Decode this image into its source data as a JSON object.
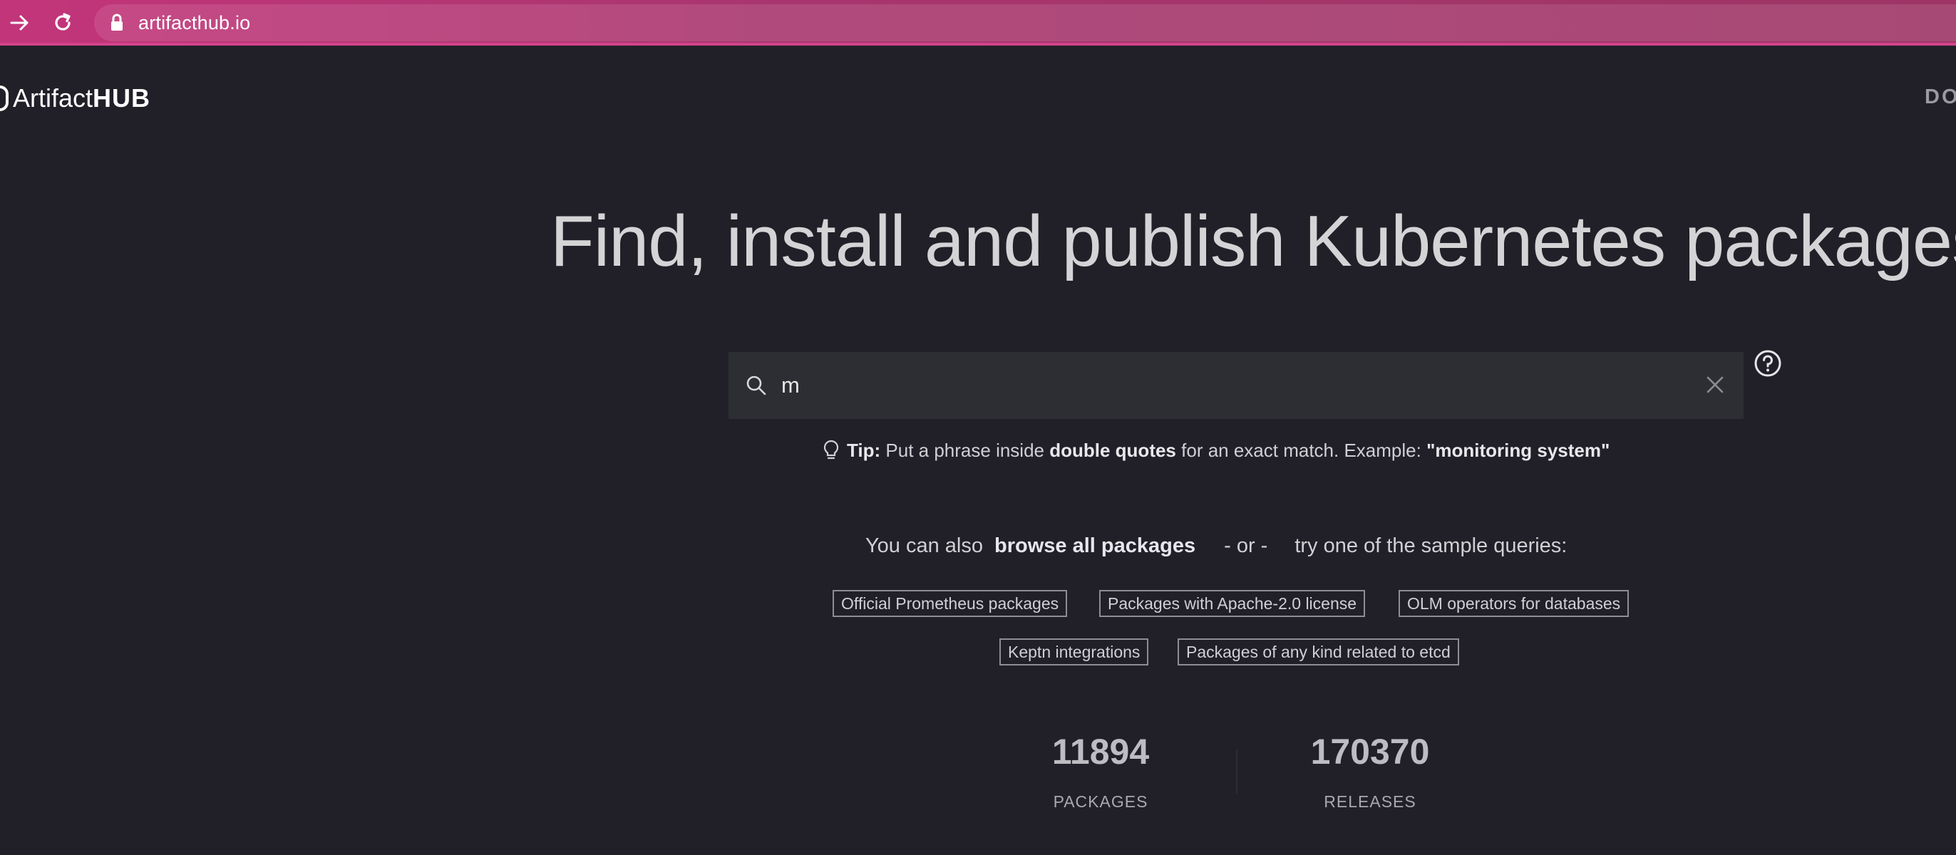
{
  "browser": {
    "url": "artifacthub.io"
  },
  "header": {
    "logo_prefix": "Artifact",
    "logo_strong": "HUB",
    "nav_link": "DO"
  },
  "hero": {
    "title": "Find, install and publish Kubernetes packages"
  },
  "search": {
    "value": "m"
  },
  "tip": {
    "label": "Tip:",
    "text1": " Put a phrase inside ",
    "emph1": "double quotes",
    "text2": " for an exact match. Example: ",
    "example": "\"monitoring system\""
  },
  "browse": {
    "prefix": "You can also",
    "link": "browse all packages",
    "separator": "- or -",
    "suffix": "try one of the sample queries:"
  },
  "sample_queries": [
    "Official Prometheus packages",
    "Packages with Apache-2.0 license",
    "OLM operators for databases",
    "Keptn integrations",
    "Packages of any kind related to etcd"
  ],
  "stats": {
    "packages_count": "11894",
    "packages_label": "PACKAGES",
    "releases_count": "170370",
    "releases_label": "RELEASES"
  },
  "colors": {
    "background": "#212028",
    "browser_bar": "#a8366e",
    "search_bg": "#2c2e33"
  },
  "icons": [
    "arrow-right-icon",
    "reload-icon",
    "lock-icon",
    "search-icon",
    "close-icon",
    "question-circle-icon",
    "lightbulb-icon"
  ]
}
